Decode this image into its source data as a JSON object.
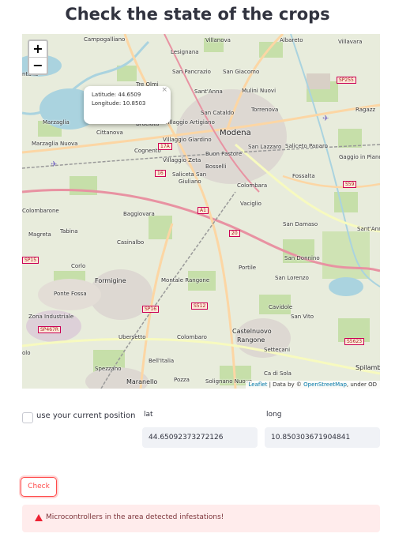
{
  "page": {
    "title": "Check the state of the crops"
  },
  "map": {
    "zoom_in": "+",
    "zoom_out": "−",
    "popup": {
      "latitude_line": "Latitude: 44.6509",
      "longitude_line": "Longitude: 10.8503",
      "close": "×"
    },
    "attribution": {
      "leaflet": "Leaflet",
      "data_by": "| Data by ©",
      "osm": "OpenStreetMap",
      "under": ", under OD"
    },
    "labels": {
      "campogalliano": "Campogalliano",
      "villanova": "Villanova",
      "albareto": "Albareto",
      "villavara": "Villavara",
      "lesignana": "Lesignana",
      "san_pancrazio": "San Pancrazio",
      "san_giacomo": "San Giacomo",
      "tre_olmi": "Tre Olmi",
      "santanna": "Sant'Anna",
      "mulini_nuovi": "Mulini Nuovi",
      "marzaglia": "Marzaglia",
      "torrenova": "Torrenova",
      "cittanova": "Cittanova",
      "bruciata": "Bruciata",
      "villaggio_artigiano": "Villaggio Artigiano",
      "san_cataldo": "San Cataldo",
      "ragazz": "Ragazz",
      "modena": "Modena",
      "marzaglia_nuova": "Marzaglia Nuova",
      "villaggio_giardino": "Villaggio Giardino",
      "san_lazzaro": "San Lazzaro",
      "saliceto_panaro": "Saliceto Panaro",
      "cognento": "Cognento",
      "buon_pastore": "Buon Pastore",
      "gaggio_in_piano": "Gaggio in Piano",
      "villaggio_zeta": "Villaggio Zeta",
      "bosselli": "Bosselli",
      "fossalta": "Fossalta",
      "saliceta_san": "Saliceta San",
      "giuliano": "Giuliano",
      "colombara": "Colombara",
      "vaciglio": "Vaciglio",
      "colombarone": "Colombarone",
      "baggiovara": "Baggiovara",
      "san_damaso": "San Damaso",
      "sant_anna_east": "Sant'Anna",
      "magreta": "Magreta",
      "tabina": "Tabina",
      "casinalbo": "Casinalbo",
      "san_donnino": "San Donnino",
      "corlo": "Corlo",
      "portile": "Portile",
      "formigine": "Formigine",
      "montale_rangone": "Montale Rangone",
      "san_lorenzo": "San Lorenzo",
      "ponte_fossa": "Ponte Fossa",
      "cavidole": "Cavidole",
      "zona_industriale": "Zona Industriale",
      "san_vito": "San Vito",
      "castelnuovo": "Castelnuovo",
      "rangone": "Rangone",
      "ubersetto": "Ubersetto",
      "colombaro": "Colombaro",
      "settecani": "Settecani",
      "bellitalia": "Bell'Italia",
      "spezzano": "Spezzano",
      "ca_di_sola": "Ca di Sola",
      "spilamb": "Spilamb",
      "maranello": "Maranello",
      "pozza": "Pozza",
      "solignano_nuovo": "Solignano Nuovo",
      "olo": "olo",
      "ntana": "ntana"
    },
    "shields": {
      "sp255": "SP255",
      "a1": "A1",
      "s59": "S59",
      "sp15": "SP15",
      "sp16": "SP16",
      "s512": "S512",
      "sp467r": "SP467R",
      "s5623": "S5623",
      "n20": "20",
      "n16": "16",
      "n17a": "17A"
    }
  },
  "position": {
    "checkbox_label": "use your current position",
    "lat_label": "lat",
    "long_label": "long",
    "lat_value": "44.65092373272126",
    "long_value": "10.850303671904841"
  },
  "actions": {
    "check_label": "Check"
  },
  "alert": {
    "message": "Microcontrollers in the area detected infestations!"
  }
}
